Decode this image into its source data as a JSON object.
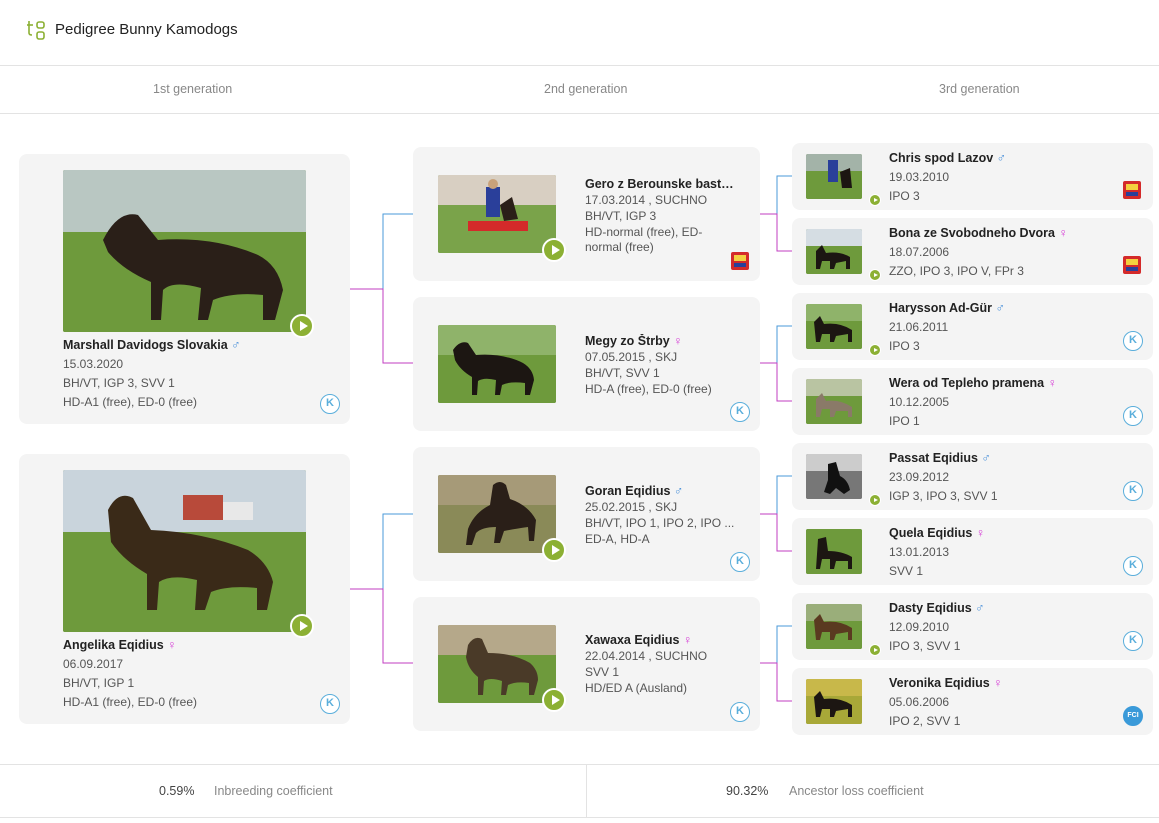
{
  "header": {
    "title": "Pedigree Bunny Kamodogs",
    "logo_icon": "tg-logo-icon"
  },
  "generations": [
    "1st generation",
    "2nd generation",
    "3rd generation"
  ],
  "colors": {
    "accent": "#8cb034",
    "male": "#4a90d9",
    "female": "#d63ed6",
    "line_male": "#4a9ad9",
    "line_female": "#c23cc2"
  },
  "gen1": [
    {
      "name": "Marshall Davidogs Slovakia",
      "sex": "♂",
      "date": "15.03.2020",
      "lines": [
        "BH/VT, IGP 3, SVV 1",
        "HD-A1 (free), ED-0 (free)"
      ],
      "badge": "K"
    },
    {
      "name": "Angelika Eqidius",
      "sex": "♀",
      "date": "06.09.2017",
      "lines": [
        "BH/VT, IGP 1",
        "HD-A1 (free), ED-0 (free)"
      ],
      "badge": "K"
    }
  ],
  "gen2": [
    {
      "name": "Gero z Berounske basty ...",
      "sex": "",
      "date": "17.03.2014 , SUCHNO",
      "lines": [
        "BH/VT, IGP 3",
        "HD-normal (free), ED-normal (free)"
      ],
      "badge": "flag"
    },
    {
      "name": "Megy zo Štrby",
      "sex": "♀",
      "date": "07.05.2015 , SKJ",
      "lines": [
        "BH/VT, SVV 1",
        "HD-A (free), ED-0 (free)"
      ],
      "badge": "K"
    },
    {
      "name": "Goran Eqidius",
      "sex": "♂",
      "date": "25.02.2015 , SKJ",
      "lines": [
        "BH/VT, IPO 1, IPO 2, IPO ...",
        "ED-A, HD-A"
      ],
      "badge": "K"
    },
    {
      "name": "Xawaxa Eqidius",
      "sex": "♀",
      "date": "22.04.2014 , SUCHNO",
      "lines": [
        "SVV 1",
        "HD/ED A (Ausland)"
      ],
      "badge": "K"
    }
  ],
  "gen3": [
    {
      "name": "Chris spod Lazov",
      "sex": "♂",
      "date": "19.03.2010",
      "line": "IPO 3",
      "badge": "flag"
    },
    {
      "name": "Bona ze Svobodneho Dvora",
      "sex": "♀",
      "date": "18.07.2006",
      "line": "ZZO, IPO 3, IPO V, FPr 3",
      "badge": "flag"
    },
    {
      "name": "Harysson Ad-Gür",
      "sex": "♂",
      "date": "21.06.2011",
      "line": "IPO 3",
      "badge": "K"
    },
    {
      "name": "Wera od Tepleho pramena",
      "sex": "♀",
      "date": "10.12.2005",
      "line": "IPO 1",
      "badge": "K"
    },
    {
      "name": "Passat Eqidius",
      "sex": "♂",
      "date": "23.09.2012",
      "line": "IGP 3, IPO 3, SVV 1",
      "badge": "K"
    },
    {
      "name": "Quela Eqidius",
      "sex": "♀",
      "date": "13.01.2013",
      "line": "SVV 1",
      "badge": "K"
    },
    {
      "name": "Dasty Eqidius",
      "sex": "♂",
      "date": "12.09.2010",
      "line": "IPO 3, SVV 1",
      "badge": "K"
    },
    {
      "name": "Veronika Eqidius",
      "sex": "♀",
      "date": "05.06.2006",
      "line": "IPO 2, SVV 1",
      "badge": "FCI"
    }
  ],
  "footer": {
    "inbreeding_value": "0.59%",
    "inbreeding_label": "Inbreeding coefficient",
    "ancestor_value": "90.32%",
    "ancestor_label": "Ancestor loss coefficient"
  }
}
